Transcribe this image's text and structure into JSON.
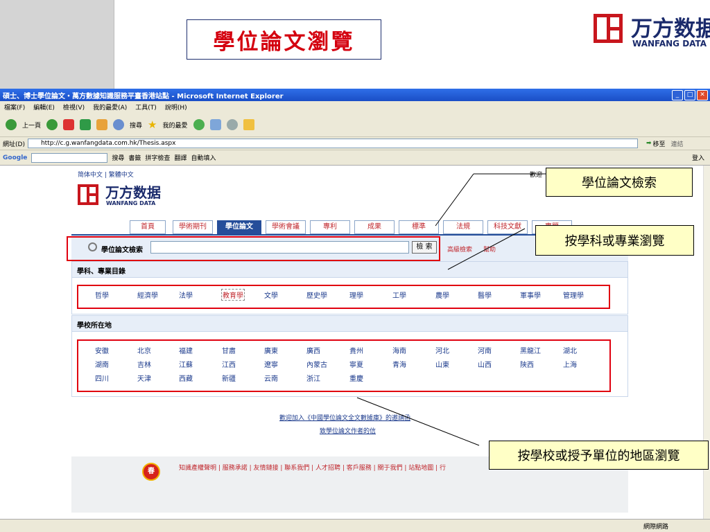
{
  "slide": {
    "title": "學位論文瀏覽",
    "logo_cn": "万方数据",
    "logo_en": "WANFANG DATA"
  },
  "browser": {
    "title": "碩士、博士學位論文・萬方數據知識服務平臺香港站點 - Microsoft Internet Explorer",
    "menu": [
      "檔案(F)",
      "編輯(E)",
      "檢視(V)",
      "我的最愛(A)",
      "工具(T)",
      "說明(H)"
    ],
    "toolbar": {
      "back": "上一頁",
      "search": "搜尋",
      "favorites": "我的最愛"
    },
    "address_label": "網址(D)",
    "address": "http://c.g.wanfangdata.com.hk/Thesis.aspx",
    "go": "移至",
    "links": "連結",
    "google": {
      "brand": "Google",
      "search": "搜尋",
      "bookmarks": "書籤",
      "spell": "拼字檢查",
      "translate": "翻譯",
      "autofill": "自動填入",
      "signin": "登入"
    },
    "status": "網際網路"
  },
  "page": {
    "lang_simplified": "简体中文",
    "lang_traditional": "繁體中文",
    "welcome": "歡迎",
    "nav_tabs": [
      "首頁",
      "學術期刊",
      "學位論文",
      "學術會議",
      "專利",
      "成果",
      "標準",
      "法規",
      "科技文獻",
      "專題"
    ],
    "search_label": "學位論文檢索",
    "search_button": "檢 索",
    "advanced_link": "高級檢索",
    "help_link": "幫助",
    "subject_heading": "學科、專業目錄",
    "subjects": [
      "哲學",
      "經濟學",
      "法學",
      "教育學",
      "文學",
      "歷史學",
      "理學",
      "工學",
      "農學",
      "醫學",
      "軍事學",
      "管理學"
    ],
    "region_heading": "學校所在地",
    "regions_row1": [
      "安徽",
      "北京",
      "福建",
      "甘肅",
      "廣東",
      "廣西",
      "貴州",
      "海南",
      "河北",
      "河南",
      "黑龍江",
      "湖北"
    ],
    "regions_row2": [
      "湖南",
      "吉林",
      "江蘇",
      "江西",
      "遼寧",
      "內蒙古",
      "寧夏",
      "青海",
      "山東",
      "山西",
      "陝西",
      "上海"
    ],
    "regions_row3": [
      "四川",
      "天津",
      "西藏",
      "新疆",
      "云南",
      "浙江",
      "重慶"
    ],
    "invite_link": "歡迎加入《中國學位論文全文數據庫》的邀請函",
    "letter_link": "致學位論文作者的信",
    "footer_links": "知識產權聲明 | 服務承諾 | 友情鏈接 | 聯系我們 | 人才招聘 | 客戶服務 | 關于我們 | 站點地圖 | 行",
    "footer_emblem": "春"
  },
  "callouts": {
    "search": "學位論文檢索",
    "subject": "按學科或專業瀏覽",
    "region": "按學校或授予單位的地區瀏覽"
  },
  "colors": {
    "highlight_red": "#e0000f",
    "nav_blue": "#254e9a",
    "callout_bg": "#ffffc6"
  }
}
